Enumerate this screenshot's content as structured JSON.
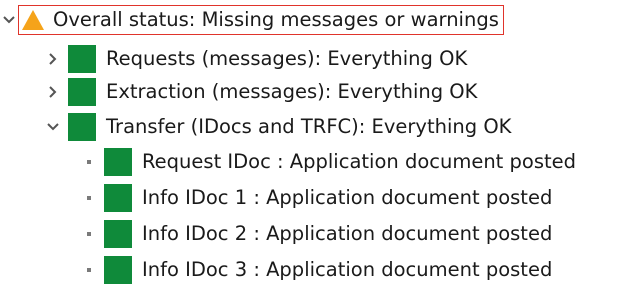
{
  "colors": {
    "ok_green": "#0f8a3a",
    "warning_orange": "#f5a31a",
    "focus_border": "#e0342b",
    "expander": "#555555"
  },
  "tree": {
    "root": {
      "icon": "warning-triangle-icon",
      "expanded": true,
      "label": "Overall status: Missing messages or warnings"
    },
    "children": [
      {
        "label": "Requests (messages): Everything OK",
        "icon": "green-status-icon",
        "expanded": false
      },
      {
        "label": "Extraction (messages): Everything OK",
        "icon": "green-status-icon",
        "expanded": false
      },
      {
        "label": "Transfer (IDocs and TRFC): Everything OK",
        "icon": "green-status-icon",
        "expanded": true,
        "children": [
          {
            "label": "Request IDoc : Application document posted",
            "icon": "green-status-icon"
          },
          {
            "label": "Info IDoc 1 : Application document posted",
            "icon": "green-status-icon"
          },
          {
            "label": "Info IDoc 2 : Application document posted",
            "icon": "green-status-icon"
          },
          {
            "label": "Info IDoc 3 : Application document posted",
            "icon": "green-status-icon"
          }
        ]
      }
    ]
  }
}
